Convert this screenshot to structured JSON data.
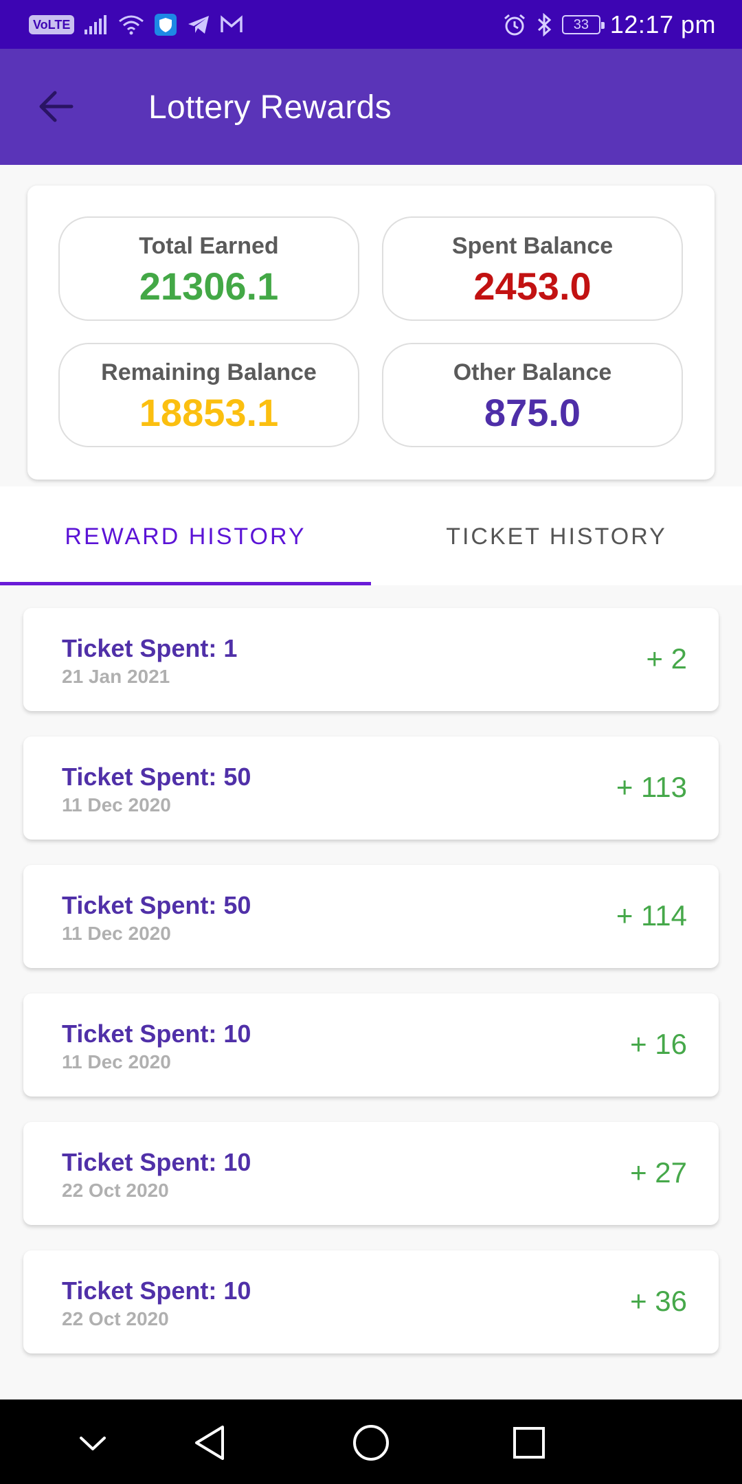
{
  "status_bar": {
    "network_badge": "VoLTE",
    "battery_level": "33",
    "time": "12:17 pm",
    "icons": [
      "signal-icon",
      "wifi-icon",
      "shield-icon",
      "telegram-icon",
      "gmail-icon",
      "alarm-icon",
      "bluetooth-icon",
      "battery-icon"
    ]
  },
  "app_bar": {
    "title": "Lottery Rewards",
    "back_icon": "arrow-left-icon"
  },
  "summary": {
    "total_earned": {
      "label": "Total Earned",
      "value": "21306.1",
      "color": "#43a846"
    },
    "spent_balance": {
      "label": "Spent Balance",
      "value": "2453.0",
      "color": "#c21212"
    },
    "remaining_balance": {
      "label": "Remaining Balance",
      "value": "18853.1",
      "color": "#fbbf10"
    },
    "other_balance": {
      "label": "Other Balance",
      "value": "875.0",
      "color": "#4e2ea8"
    }
  },
  "tabs": [
    {
      "label": "REWARD HISTORY",
      "active": true
    },
    {
      "label": "TICKET HISTORY",
      "active": false
    }
  ],
  "rewards": [
    {
      "title": "Ticket Spent: 1",
      "date": "21 Jan 2021",
      "amount": "+ 2"
    },
    {
      "title": "Ticket Spent: 50",
      "date": "11 Dec 2020",
      "amount": "+ 113"
    },
    {
      "title": "Ticket Spent: 50",
      "date": "11 Dec 2020",
      "amount": "+ 114"
    },
    {
      "title": "Ticket Spent: 10",
      "date": "11 Dec 2020",
      "amount": "+ 16"
    },
    {
      "title": "Ticket Spent: 10",
      "date": "22 Oct 2020",
      "amount": "+ 27"
    },
    {
      "title": "Ticket Spent: 10",
      "date": "22 Oct 2020",
      "amount": "+ 36"
    }
  ],
  "nav_bar": {
    "icons": [
      "chevron-down-icon",
      "back-triangle-icon",
      "home-circle-icon",
      "recents-square-icon"
    ]
  },
  "colors": {
    "status_bar": "#3d05b3",
    "app_bar": "#5a34b8",
    "tab_active": "#5b13d6",
    "item_title": "#5030a8",
    "item_amount": "#46a84a"
  }
}
